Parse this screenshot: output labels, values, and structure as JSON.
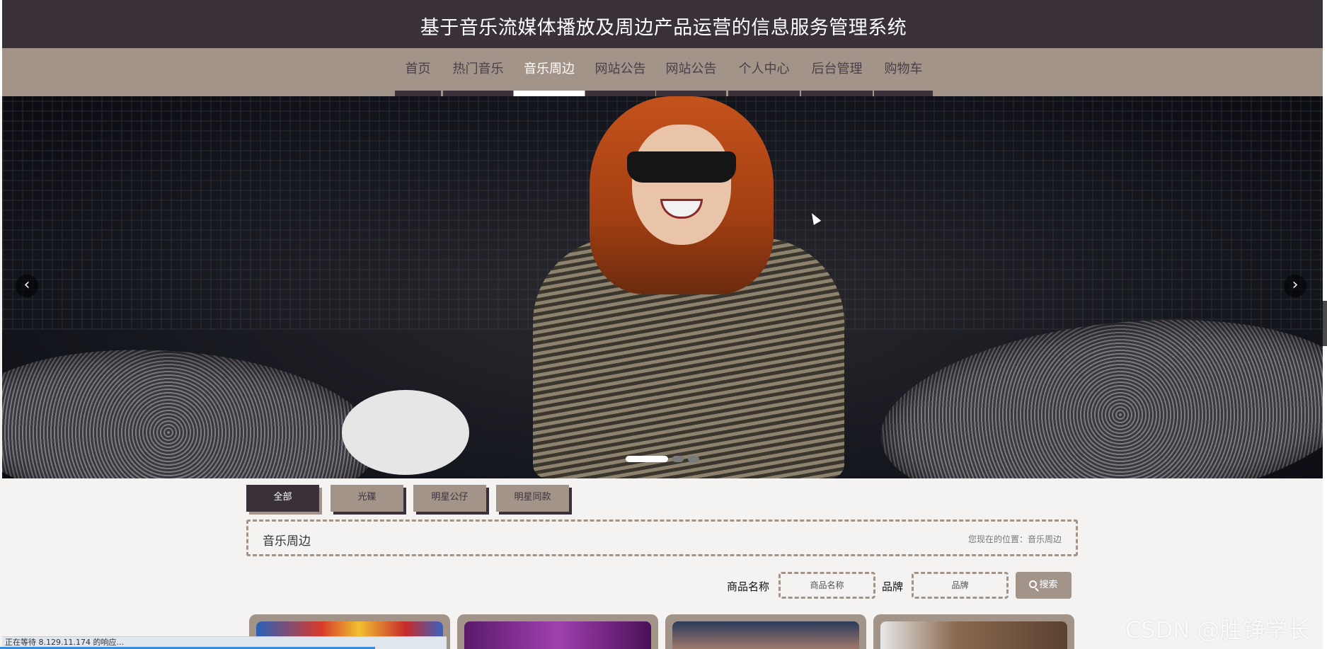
{
  "header": {
    "title": "基于音乐流媒体播放及周边产品运营的信息服务管理系统"
  },
  "nav": {
    "items": [
      {
        "label": "首页"
      },
      {
        "label": "热门音乐"
      },
      {
        "label": "音乐周边",
        "active": true
      },
      {
        "label": "网站公告"
      },
      {
        "label": "网站公告"
      },
      {
        "label": "个人中心"
      },
      {
        "label": "后台管理"
      },
      {
        "label": "购物车"
      }
    ]
  },
  "banner": {
    "prev_icon": "chevron-left-icon",
    "next_icon": "chevron-right-icon",
    "slides_count": 3,
    "active_slide": 1
  },
  "categories": [
    {
      "label": "全部",
      "active": true
    },
    {
      "label": "光碟"
    },
    {
      "label": "明星公仔"
    },
    {
      "label": "明星同款"
    }
  ],
  "breadcrumb": {
    "title": "音乐周边",
    "location": "您现在的位置：音乐周边"
  },
  "search": {
    "name_label": "商品名称",
    "name_placeholder": "商品名称",
    "brand_label": "品牌",
    "brand_placeholder": "品牌",
    "button_label": "搜索"
  },
  "status": {
    "text": "正在等待 8.129.11.174 的响应..."
  },
  "watermark": "CSDN @胜铮学长",
  "colors": {
    "primary_dark": "#3a3039",
    "primary_light": "#a39489",
    "background": "#f4f3f2"
  }
}
